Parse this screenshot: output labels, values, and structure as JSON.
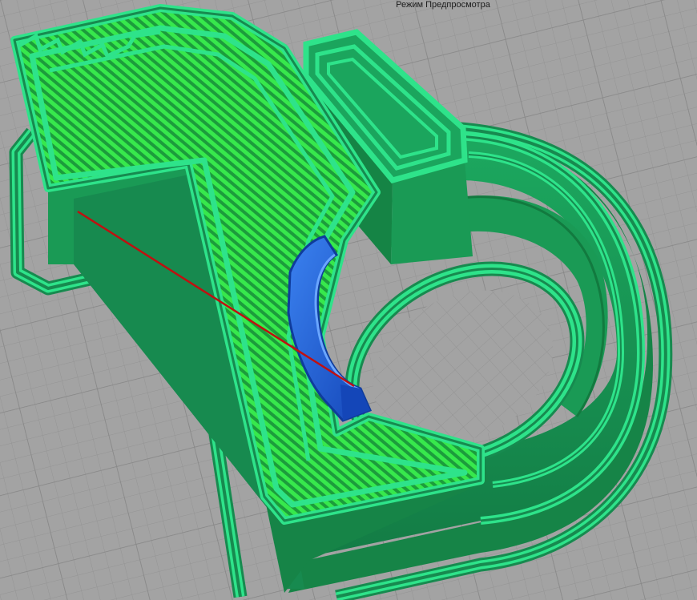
{
  "viewer": {
    "mode_label": "Режим Предпросмотра"
  },
  "colors": {
    "build_plate": "#a3a3a3",
    "grid_minor": "#9a9a9a",
    "grid_major": "#8c8c8c",
    "wall_dark": "#178a4f",
    "wall_mid": "#1fae63",
    "perimeter_light": "#2ee38a",
    "infill_bright": "#33e44a",
    "infill_dark": "#1a9a3c",
    "travel_line": "#c01010",
    "extruder_path": "#1f62d9"
  }
}
